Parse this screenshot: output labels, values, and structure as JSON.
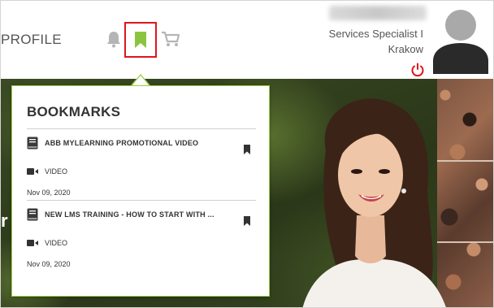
{
  "header": {
    "profile_label": "PROFILE",
    "user": {
      "role_line1": "Services Specialist I",
      "role_line2": "Krakow"
    },
    "icons": {
      "notifications": "bell-icon",
      "bookmarks": "bookmark-icon",
      "cart": "cart-icon",
      "logout": "power-icon",
      "avatar": "user-avatar"
    },
    "highlight_color": "#e0151b",
    "bookmark_active_color": "#8bc53f"
  },
  "banner": {
    "partial_text": "r"
  },
  "bookmarks_popup": {
    "title": "BOOKMARKS",
    "items": [
      {
        "title": "ABB MYLEARNING PROMOTIONAL VIDEO",
        "type": "VIDEO",
        "date": "Nov 09, 2020"
      },
      {
        "title": "NEW LMS TRAINING - HOW TO START WITH ...",
        "type": "VIDEO",
        "date": "Nov 09, 2020"
      }
    ],
    "border_color": "#9ed04a"
  }
}
